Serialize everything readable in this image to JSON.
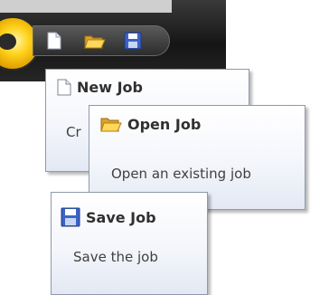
{
  "icons": {
    "new": "new-job-icon",
    "open": "open-job-icon",
    "save": "save-job-icon"
  },
  "tooltips": {
    "new_job": {
      "title": "New Job",
      "description": "Cr"
    },
    "open_job": {
      "title": "Open Job",
      "description": "Open an existing job"
    },
    "save_job": {
      "title": "Save Job",
      "description": "Save the job"
    }
  },
  "colors": {
    "toolbar_dark": "#1f1f1f",
    "orb": "#ffd21a",
    "tooltip_border": "#8f99aa",
    "tooltip_text": "#303030"
  }
}
